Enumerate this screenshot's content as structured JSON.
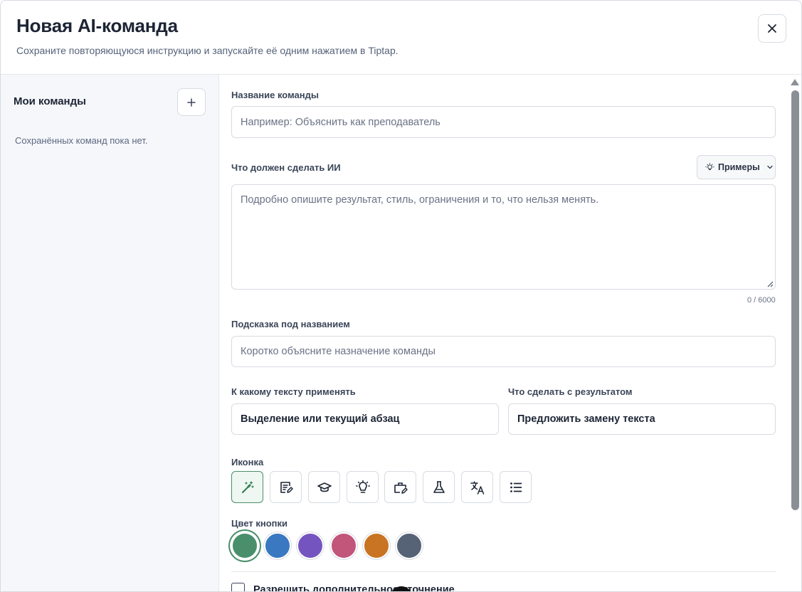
{
  "header": {
    "title": "Новая AI-команда",
    "subtitle": "Сохраните повторяющуюся инструкцию и запускайте её одним нажатием в Tiptap.",
    "close_icon": "close-icon"
  },
  "sidebar": {
    "title": "Мои команды",
    "add_icon": "plus-icon",
    "empty_text": "Сохранённых команд пока нет."
  },
  "form": {
    "name": {
      "label": "Название команды",
      "placeholder": "Например: Объяснить как преподаватель",
      "value": ""
    },
    "instruction": {
      "label": "Что должен сделать ИИ",
      "placeholder": "Подробно опишите результат, стиль, ограничения и то, что нельзя менять.",
      "counter": "0 / 6000",
      "examples_label": "Примеры"
    },
    "hint": {
      "label": "Подсказка под названием",
      "placeholder": "Коротко объясните назначение команды"
    },
    "scope": {
      "label": "К какому тексту применять",
      "value": "Выделение или текущий абзац"
    },
    "result": {
      "label": "Что сделать с результатом",
      "value": "Предложить замену текста"
    },
    "icon": {
      "label": "Иконка",
      "options": [
        "magic-wand-icon",
        "edit-note-icon",
        "graduation-cap-icon",
        "lightbulb-icon",
        "briefcase-edit-icon",
        "flask-icon",
        "translate-icon",
        "list-icon"
      ],
      "selected": "magic-wand-icon"
    },
    "color": {
      "label": "Цвет кнопки",
      "options": [
        "#4a8f6c",
        "#3a78c2",
        "#7455c0",
        "#c2557a",
        "#c97423",
        "#566275"
      ],
      "selected": "#4a8f6c"
    },
    "extra_option": {
      "label": "Разрешить дополнительное уточнение",
      "checked": false
    }
  }
}
